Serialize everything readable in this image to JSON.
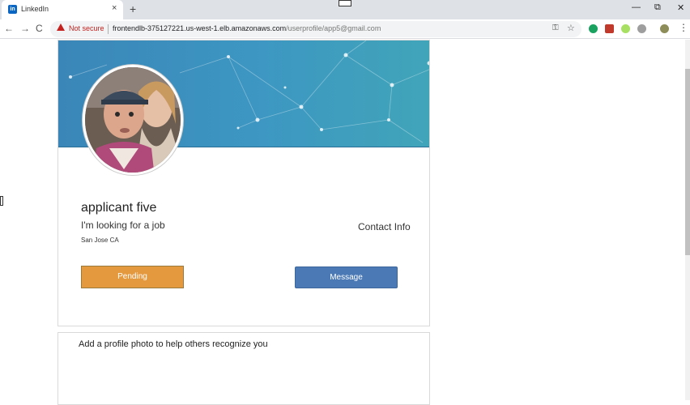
{
  "browser": {
    "tab_title": "LinkedIn",
    "tab_favicon_text": "in",
    "tab_close": "×",
    "new_tab": "+",
    "minimize": "—",
    "restore": "⧉",
    "close": "✕",
    "back": "←",
    "forward": "→",
    "reload": "C",
    "security_label": "Not secure",
    "url_host": "frontendlb-375127221.us-west-1.elb.amazonaws.com",
    "url_path": "/userprofile/app5@gmail.com",
    "key_icon": "⚿",
    "star_icon": "☆",
    "menu_icon": "⋮"
  },
  "profile": {
    "name": "applicant five",
    "headline": "I'm looking for a job",
    "location": "San Jose CA",
    "contact_label": "Contact Info",
    "pending_label": "Pending",
    "message_label": "Message"
  },
  "prompt_card": {
    "text": "Add a profile photo to help others recognize you"
  },
  "colors": {
    "banner": "#3d97c2",
    "pending_button": "#e5993f",
    "message_button": "#4a79b5",
    "not_secure": "#c5221f"
  }
}
